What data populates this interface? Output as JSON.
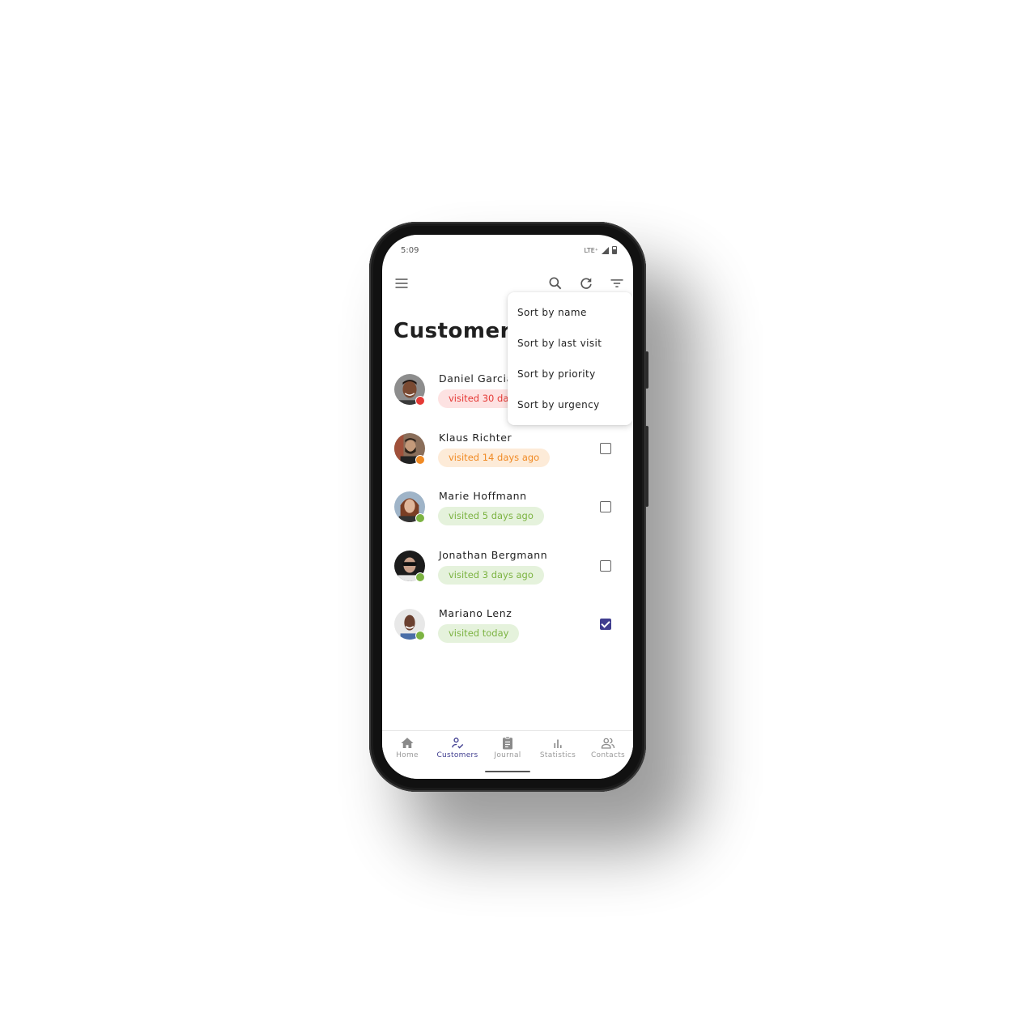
{
  "status_bar": {
    "time": "5:09",
    "network": "LTE⁺"
  },
  "toolbar": {
    "menu_icon": "menu-icon",
    "search_icon": "search-icon",
    "refresh_icon": "refresh-icon",
    "filter_icon": "filter-icon"
  },
  "page": {
    "title": "Customers"
  },
  "sort_menu": {
    "items": [
      {
        "label": "Sort by name"
      },
      {
        "label": "Sort by last visit"
      },
      {
        "label": "Sort by priority"
      },
      {
        "label": "Sort by urgency"
      }
    ]
  },
  "customers": [
    {
      "name": "Daniel Garcia",
      "visit": "visited 30 days ago",
      "status": "red",
      "checked": false
    },
    {
      "name": "Klaus Richter",
      "visit": "visited 14 days ago",
      "status": "orange",
      "checked": false
    },
    {
      "name": "Marie Hoffmann",
      "visit": "visited 5 days ago",
      "status": "green",
      "checked": false
    },
    {
      "name": "Jonathan Bergmann",
      "visit": "visited 3 days ago",
      "status": "green",
      "checked": false
    },
    {
      "name": "Mariano Lenz",
      "visit": "visited today",
      "status": "green",
      "checked": true
    }
  ],
  "colors": {
    "accent": "#3f3d8f",
    "status_red": "#e53935",
    "status_orange": "#f08a24",
    "status_green": "#7cb342"
  },
  "bottom_nav": {
    "items": [
      {
        "label": "Home",
        "icon": "home-icon",
        "active": false
      },
      {
        "label": "Customers",
        "icon": "customers-icon",
        "active": true
      },
      {
        "label": "Journal",
        "icon": "journal-icon",
        "active": false
      },
      {
        "label": "Statistics",
        "icon": "statistics-icon",
        "active": false
      },
      {
        "label": "Contacts",
        "icon": "contacts-icon",
        "active": false
      }
    ]
  }
}
